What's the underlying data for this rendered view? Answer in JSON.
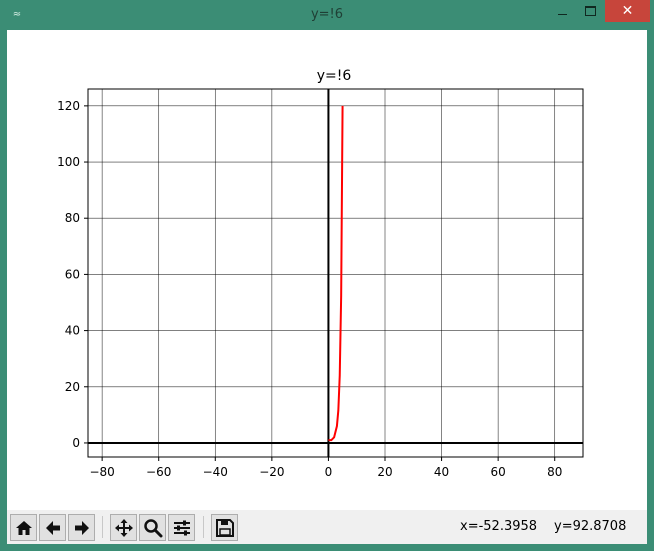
{
  "window": {
    "title": "y=!6",
    "app_icon": "matplotlib-icon"
  },
  "toolbar": {
    "buttons": [
      {
        "name": "home-button",
        "icon": "home-icon"
      },
      {
        "name": "back-button",
        "icon": "arrow-left-icon"
      },
      {
        "name": "forward-button",
        "icon": "arrow-right-icon"
      },
      {
        "name": "pan-button",
        "icon": "move-icon"
      },
      {
        "name": "zoom-button",
        "icon": "magnifier-icon"
      },
      {
        "name": "subplots-button",
        "icon": "sliders-icon"
      },
      {
        "name": "save-button",
        "icon": "floppy-icon"
      }
    ]
  },
  "status": {
    "x_readout": "x=-52.3958",
    "y_readout": "y=92.8708"
  },
  "chart_data": {
    "type": "line",
    "title": "y=!6",
    "xlabel": "",
    "ylabel": "",
    "xlim": [
      -85,
      90
    ],
    "ylim": [
      -5,
      126
    ],
    "xticks": [
      -80,
      -60,
      -40,
      -20,
      0,
      20,
      40,
      60,
      80
    ],
    "xtick_labels": [
      "−80",
      "−60",
      "−40",
      "−20",
      "0",
      "20",
      "40",
      "60",
      "80"
    ],
    "yticks": [
      0,
      20,
      40,
      60,
      80,
      100,
      120
    ],
    "ytick_labels": [
      "0",
      "20",
      "40",
      "60",
      "80",
      "100",
      "120"
    ],
    "grid": true,
    "series": [
      {
        "color": "#ff0000",
        "x": [
          0,
          1,
          2,
          3,
          3.5,
          4,
          4.5,
          5
        ],
        "y": [
          1,
          1,
          2,
          6,
          11.6,
          24,
          52.3,
          120
        ]
      }
    ]
  }
}
